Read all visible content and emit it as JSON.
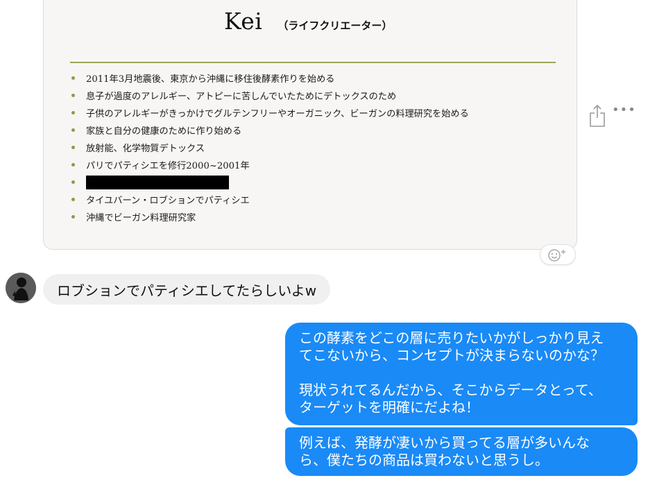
{
  "attachment": {
    "name": "Kei",
    "role": "（ライフクリエーター）",
    "bullets": [
      "2011年3月地震後、東京から沖縄に移住後酵素作りを始める",
      "息子が過度のアレルギー、アトピーに苦しんでいたためにデトックスのため",
      "子供のアレルギーがきっかけでグルテンフリーやオーガニック、ビーガンの料理研究を始める",
      "家族と自分の健康のために作り始める",
      "放射能、化学物質デトックス",
      "パリでパティシエを修行2000~2001年",
      "",
      "タイユバーン・ロブションでパティシエ",
      "沖縄でビーガン料理研究家"
    ]
  },
  "actions": {
    "share_icon": "share-icon",
    "more_label": "•••",
    "reaction_icon": "add-reaction-icon"
  },
  "messages": {
    "incoming_text": "ロブションでパティシエしてたらしいよw",
    "outgoing_1": {
      "line1": "この酵素をどこの層に売りたいかがしっかり見え",
      "line2": "てこないから、コンセプトが決まらないのかな？",
      "line3": "現状うれてるんだから、そこからデータとって、",
      "line4": "ターゲットを明確にだよね！"
    },
    "outgoing_2": {
      "line1": "例えば、発酵が凄いから買ってる層が多いんな",
      "line2": "ら、僕たちの商品は買わないと思うし。"
    }
  },
  "colors": {
    "outgoing_bubble": "#1a8af6",
    "incoming_bubble": "#f0f0f0",
    "accent_rule": "#9ba75a"
  }
}
